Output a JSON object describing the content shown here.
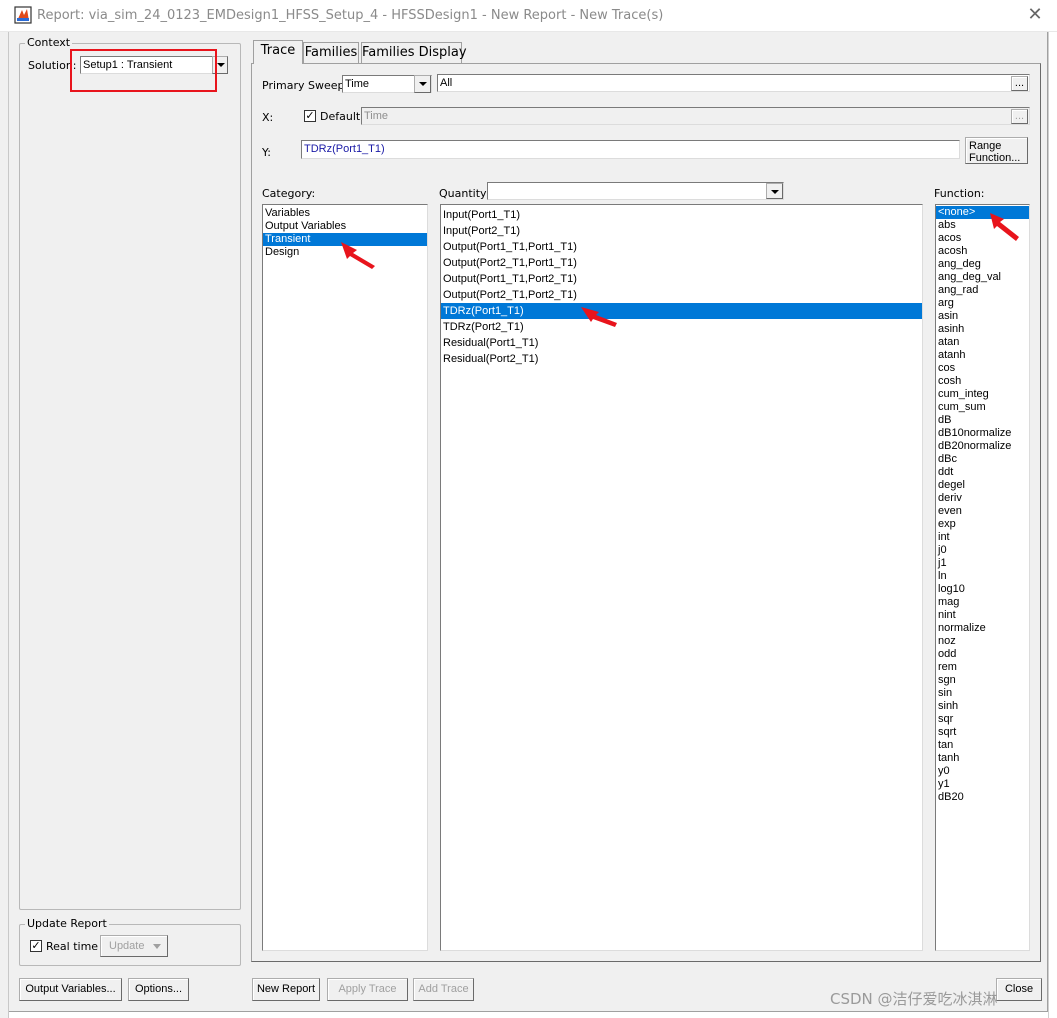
{
  "window": {
    "title": "Report: via_sim_24_0123_EMDesign1_HFSS_Setup_4 - HFSSDesign1 - New Report - New Trace(s)",
    "close_glyph": "✕"
  },
  "context": {
    "group_label": "Context",
    "solution_label": "Solution:",
    "solution_value": "Setup1 : Transient"
  },
  "update_report": {
    "group_label": "Update Report",
    "realtime_label": "Real time",
    "realtime_checked": true,
    "update_label": "Update"
  },
  "bottom_left_buttons": {
    "output_variables": "Output Variables...",
    "options": "Options..."
  },
  "tabs": [
    {
      "label": "Trace",
      "active": true
    },
    {
      "label": "Families",
      "active": false
    },
    {
      "label": "Families Display",
      "active": false
    }
  ],
  "trace": {
    "primary_sweep_label": "Primary Sweep:",
    "primary_sweep_value": "Time",
    "primary_sweep_range": "All",
    "ellipsis": "...",
    "x_label": "X:",
    "default_label": "Default",
    "default_checked": true,
    "x_value": "Time",
    "y_label": "Y:",
    "y_value": "TDRz(Port1_T1)",
    "range_function_line1": "Range",
    "range_function_line2": "Function..."
  },
  "category": {
    "label": "Category:",
    "items": [
      "Variables",
      "Output Variables",
      "Transient",
      "Design"
    ],
    "selected_index": 2
  },
  "quantity": {
    "label": "Quantity:",
    "filter_value": "",
    "items": [
      "Input(Port1_T1)",
      "Input(Port2_T1)",
      "Output(Port1_T1,Port1_T1)",
      "Output(Port2_T1,Port1_T1)",
      "Output(Port1_T1,Port2_T1)",
      "Output(Port2_T1,Port2_T1)",
      "TDRz(Port1_T1)",
      "TDRz(Port2_T1)",
      "Residual(Port1_T1)",
      "Residual(Port2_T1)"
    ],
    "selected_index": 6
  },
  "function": {
    "label": "Function:",
    "items": [
      "<none>",
      "abs",
      "acos",
      "acosh",
      "ang_deg",
      "ang_deg_val",
      "ang_rad",
      "arg",
      "asin",
      "asinh",
      "atan",
      "atanh",
      "cos",
      "cosh",
      "cum_integ",
      "cum_sum",
      "dB",
      "dB10normalize",
      "dB20normalize",
      "dBc",
      "ddt",
      "degel",
      "deriv",
      "even",
      "exp",
      "int",
      "j0",
      "j1",
      "ln",
      "log10",
      "mag",
      "nint",
      "normalize",
      "noz",
      "odd",
      "rem",
      "sgn",
      "sin",
      "sinh",
      "sqr",
      "sqrt",
      "tan",
      "tanh",
      "y0",
      "y1",
      "dB20"
    ],
    "selected_index": 0
  },
  "bottom_buttons": {
    "new_report": "New Report",
    "apply_trace": "Apply Trace",
    "add_trace": "Add Trace",
    "close": "Close"
  },
  "watermark": "CSDN @洁仔爱吃冰淇淋",
  "colors": {
    "selection": "#0078d7",
    "highlight_box": "#e8141c",
    "annotation_arrow": "#e8141c",
    "y_text": "#1a1aa6"
  }
}
